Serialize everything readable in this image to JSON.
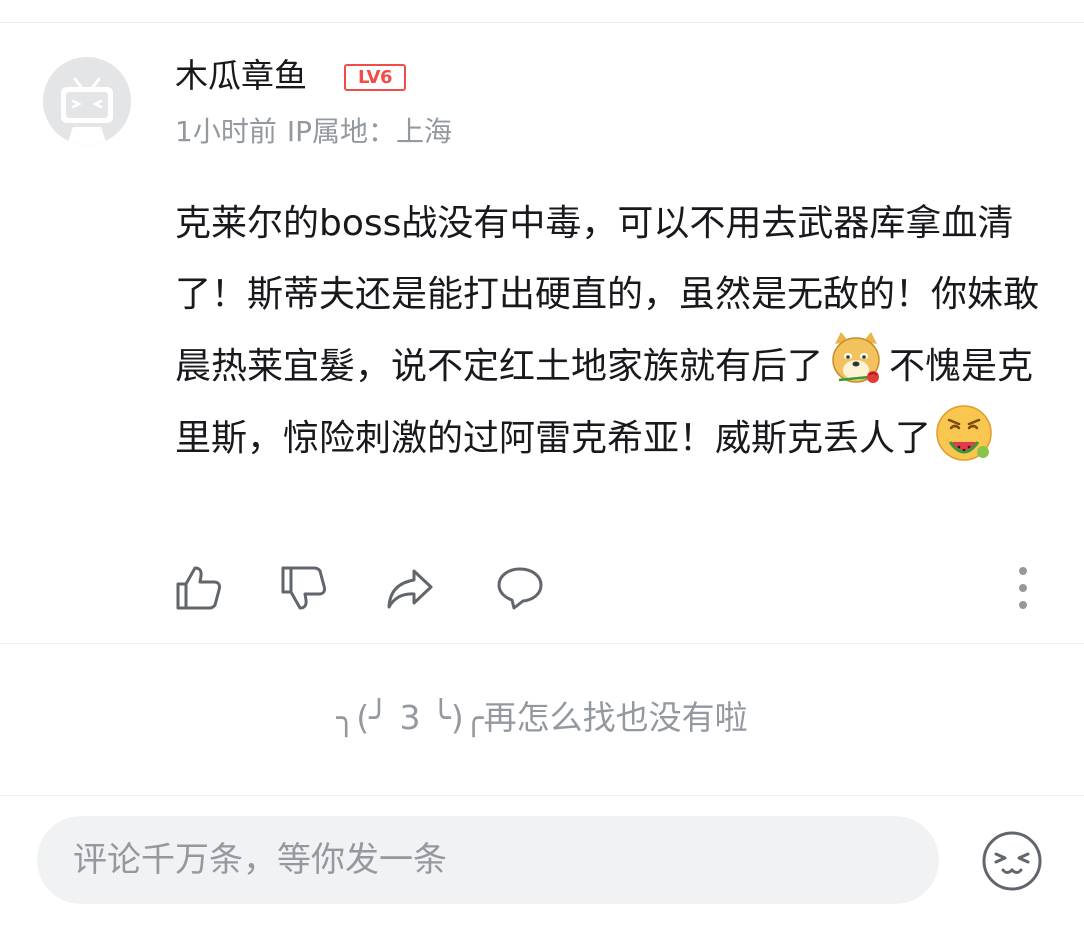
{
  "comment": {
    "username": "木瓜章鱼",
    "level": "LV6",
    "time": "1小时前",
    "ip_location": "IP属地：上海",
    "content_parts": [
      "克莱尔的boss战没有中毒，可以不用去武器库拿血清了！斯蒂夫还是能打出硬直的，虽然是无敌的！你妹敢晨热莱宜髮，说不定红土地家族就有后了",
      "不愧是克里斯，惊险刺激的过阿雷克希亚！威斯克丢人了"
    ],
    "emojis": [
      "dog-rose-emoji-icon",
      "watermelon-emoji-icon"
    ]
  },
  "actions": [
    "thumbs-up-icon",
    "thumbs-down-icon",
    "share-icon",
    "reply-icon",
    "more-icon"
  ],
  "end_hint": {
    "kaomoji": "╮(╯ 3 ╰)╭",
    "text": "再怎么找也没有啦"
  },
  "reply_input": {
    "placeholder": "评论千万条，等你发一条"
  },
  "colors": {
    "text": "#18191c",
    "muted": "#9499a0",
    "level_red": "#f04c49",
    "divider": "#eceef0",
    "input_bg": "#f1f2f3"
  }
}
